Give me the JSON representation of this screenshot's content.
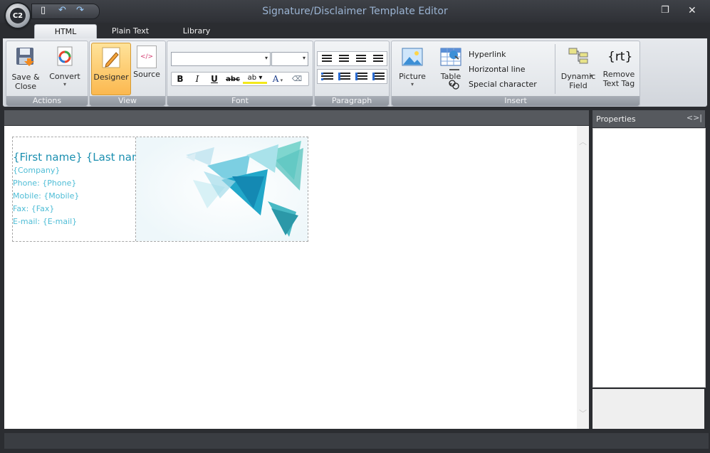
{
  "window": {
    "title": "Signature/Disclaimer Template Editor"
  },
  "tabs": [
    {
      "label": "HTML",
      "active": true
    },
    {
      "label": "Plain Text",
      "active": false
    },
    {
      "label": "Library",
      "active": false
    }
  ],
  "ribbon": {
    "actions": {
      "label": "Actions",
      "save_close": "Save &\nClose",
      "convert": "Convert"
    },
    "view": {
      "label": "View",
      "designer": "Designer",
      "source": "Source",
      "source_icon_text": "</>"
    },
    "font": {
      "label": "Font",
      "name_value": "",
      "size_value": "",
      "bold": "B",
      "italic": "I",
      "underline": "U",
      "strike": "abc",
      "highlight": "ab",
      "color": "A"
    },
    "paragraph": {
      "label": "Paragraph"
    },
    "insert": {
      "label": "Insert",
      "picture": "Picture",
      "table": "Table",
      "hyperlink": "Hyperlink",
      "horizontal_line": "Horizontal line",
      "special_character": "Special character",
      "dynamic_field": "Dynamic\nField",
      "remove_text_tag": "Remove\nText Tag",
      "rt_icon_text": "{rt}"
    }
  },
  "signature": {
    "name": "{First name} {Last name}",
    "company": "{Company}",
    "phone": "Phone: {Phone}",
    "mobile": "Mobile: {Mobile}",
    "fax": "Fax: {Fax}",
    "email": "E-mail: {E-mail}"
  },
  "properties": {
    "title": "Properties"
  },
  "colors": {
    "accent": "#1b8fb0",
    "field_text": "#4fbdd6",
    "designer_active": "#fbb84f"
  }
}
